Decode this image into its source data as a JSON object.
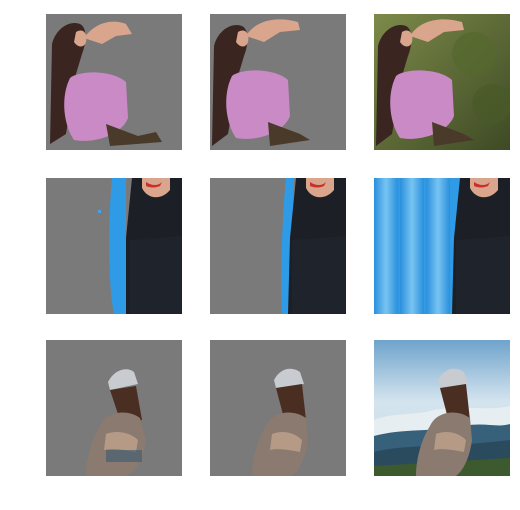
{
  "figure": {
    "grid": {
      "rows": 3,
      "columns": 3
    },
    "rows": [
      {
        "subject": "woman-pink-dress-arm-raised",
        "panels": [
          {
            "variant": "masked-coarse",
            "background": "gray"
          },
          {
            "variant": "masked-refined",
            "background": "gray"
          },
          {
            "variant": "original",
            "background": "foliage"
          }
        ]
      },
      {
        "subject": "woman-black-top-blue-float",
        "panels": [
          {
            "variant": "masked-coarse",
            "background": "gray"
          },
          {
            "variant": "masked-refined",
            "background": "gray"
          },
          {
            "variant": "original",
            "background": "blue-inflatable"
          }
        ]
      },
      {
        "subject": "person-beanie-mountain-view",
        "panels": [
          {
            "variant": "masked-coarse",
            "background": "gray"
          },
          {
            "variant": "masked-refined",
            "background": "gray"
          },
          {
            "variant": "original",
            "background": "sky-mountains"
          }
        ]
      }
    ],
    "colors": {
      "mask_gray": "#7a7a7a",
      "dress_pink": "#c98ac6",
      "hair_dark": "#3a2520",
      "skin": "#d9a58c",
      "foliage": "#5b6b34",
      "float_blue": "#2f9be6",
      "top_black": "#1f232b",
      "sky": "#bcd6e6",
      "mountain": "#37607a"
    }
  }
}
